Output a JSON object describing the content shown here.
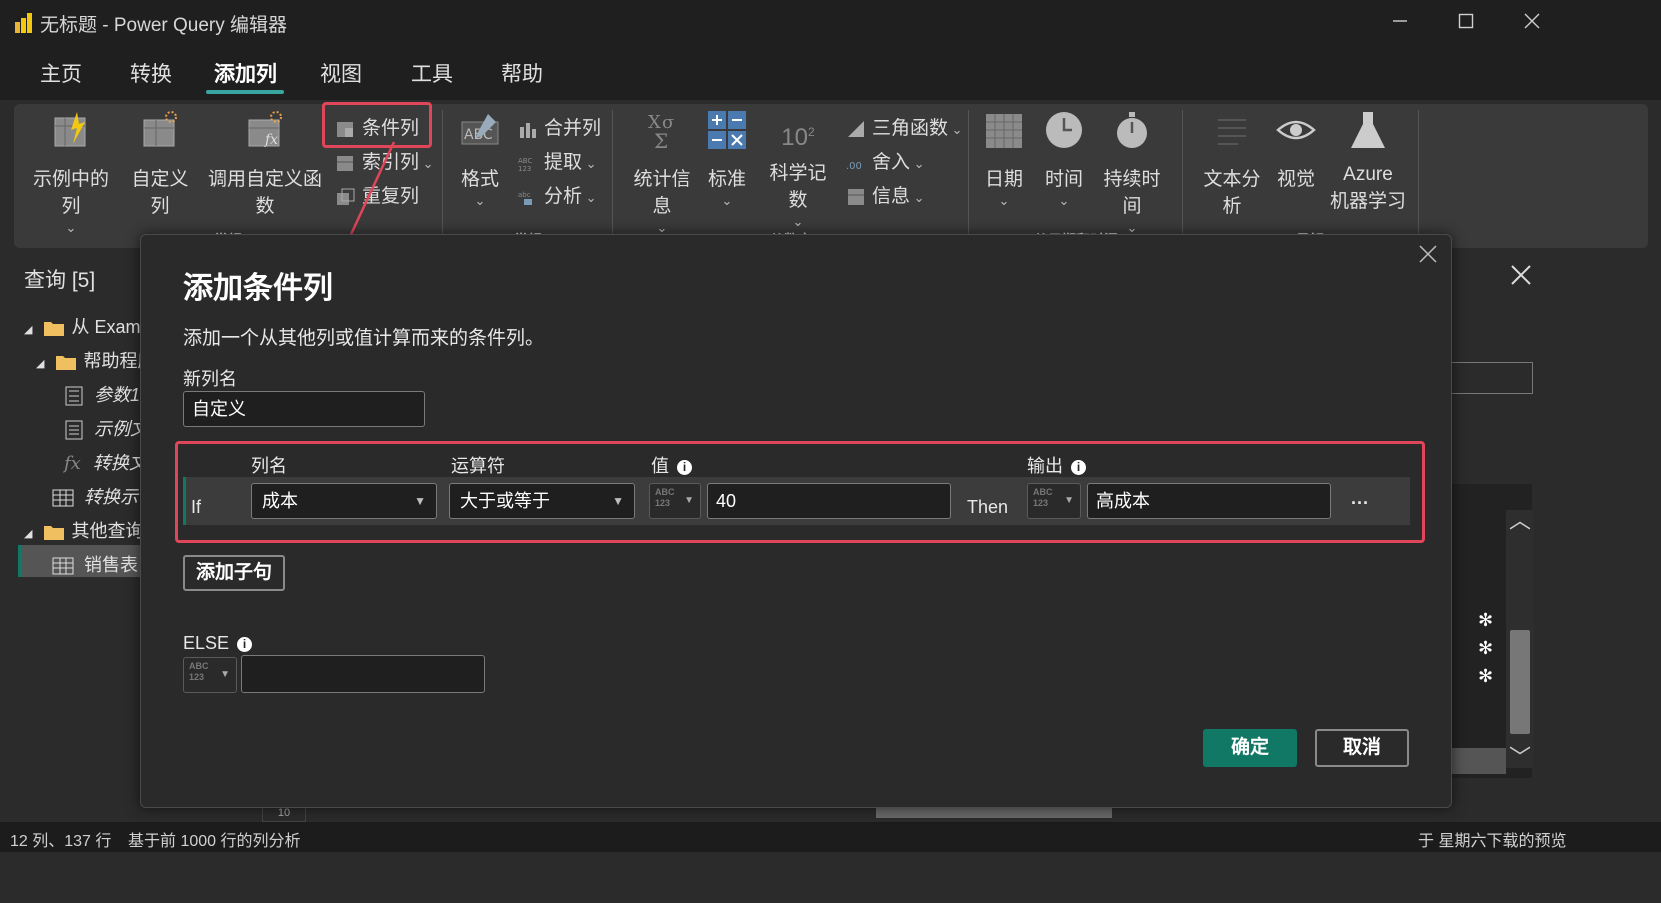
{
  "window": {
    "title": "无标题 - Power Query 编辑器",
    "minimize_icon": "minimize-icon",
    "maximize_icon": "maximize-icon",
    "close_icon": "close-icon"
  },
  "menu": {
    "tabs": [
      {
        "label": "主页"
      },
      {
        "label": "转换"
      },
      {
        "label": "添加列",
        "active": true
      },
      {
        "label": "视图"
      },
      {
        "label": "工具"
      },
      {
        "label": "帮助"
      }
    ]
  },
  "ribbon": {
    "groups": {
      "general1": "常规",
      "general2": "常规",
      "from_number": "从数字",
      "from_datetime": "从日期和时间",
      "ai": "AI 见解"
    },
    "buttons": {
      "example_column": "示例中的列",
      "custom_column": "自定义列",
      "invoke_custom_function": "调用自定义函数",
      "conditional_column": "条件列",
      "index_column": "索引列",
      "duplicate_column": "重复列",
      "format": "格式",
      "merge_columns": "合并列",
      "extract": "提取",
      "parse": "分析",
      "statistics": "统计信息",
      "standard": "标准",
      "scientific": "科学记数",
      "trigonometry": "三角函数",
      "rounding": "舍入",
      "information": "信息",
      "date": "日期",
      "time": "时间",
      "duration": "持续时间",
      "text_analytics": "文本分析",
      "vision": "视觉",
      "azure_ml_1": "Azure",
      "azure_ml_2": "机器学习",
      "scientific_sup": "10",
      "scientific_exp": "2",
      "stats_glyph": "XO\nΣ"
    }
  },
  "queries": {
    "title": "查询 [5]",
    "items": [
      {
        "label": "从 Examp",
        "type": "folder"
      },
      {
        "label": "帮助程序",
        "type": "folder"
      },
      {
        "label": "参数1",
        "type": "param"
      },
      {
        "label": "示例文",
        "type": "file"
      },
      {
        "label": "转换文",
        "type": "function"
      },
      {
        "label": "转换示",
        "type": "table"
      },
      {
        "label": "其他查询",
        "type": "folder"
      },
      {
        "label": "销售表",
        "type": "table"
      }
    ]
  },
  "dialog": {
    "title": "添加条件列",
    "description": "添加一个从其他列或值计算而来的条件列。",
    "new_column_label": "新列名",
    "new_column_value": "自定义",
    "headers": {
      "column": "列名",
      "operator": "运算符",
      "value": "值",
      "output": "输出"
    },
    "rule": {
      "if": "If",
      "column": "成本",
      "operator": "大于或等于",
      "value": "40",
      "then": "Then",
      "output": "高成本",
      "more": "···"
    },
    "type_glyph_top": "ABC",
    "type_glyph_bottom": "123",
    "add_clause": "添加子句",
    "else_label": "ELSE",
    "else_value": "",
    "ok": "确定",
    "cancel": "取消"
  },
  "background": {
    "row_number": "10"
  },
  "status": {
    "left1": "12 列、137 行",
    "left2": "基于前 1000 行的列分析",
    "right": "于 星期六下载的预览"
  },
  "colors": {
    "highlight": "#e0465a",
    "accent": "#117865",
    "tab_underline": "#3aa6a0"
  }
}
